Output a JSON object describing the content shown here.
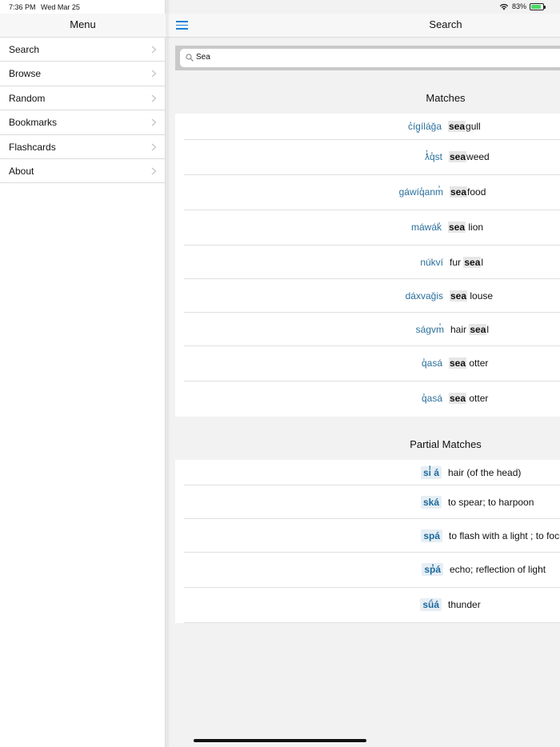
{
  "status": {
    "time": "7:36 PM",
    "date": "Wed Mar 25",
    "battery": "83%",
    "battery_level": 0.83,
    "battery_color": "#4cd964"
  },
  "sidebar": {
    "title": "Menu",
    "items": [
      {
        "label": "Search"
      },
      {
        "label": "Browse"
      },
      {
        "label": "Random"
      },
      {
        "label": "Bookmarks"
      },
      {
        "label": "Flashcards"
      },
      {
        "label": "About"
      }
    ]
  },
  "nav": {
    "title": "Search",
    "menu_icon": "hamburger-icon"
  },
  "search": {
    "value": "Sea",
    "icon": "search-icon"
  },
  "matches": {
    "title": "Matches",
    "rows": [
      {
        "word": "c̓íg̱íláǧa",
        "pre": "",
        "hl": "sea",
        "post": "gull"
      },
      {
        "word": "ƛ̓q̓st",
        "pre": "",
        "hl": "sea",
        "post": "weed"
      },
      {
        "word": "gáwíq̓anm̓",
        "pre": "",
        "hl": "sea",
        "post": "food"
      },
      {
        "word": "máwák̓",
        "pre": "",
        "hl": "sea",
        "post": " lion"
      },
      {
        "word": "núkví",
        "pre": "fur ",
        "hl": "sea",
        "post": "l"
      },
      {
        "word": "dáxvaǧis",
        "pre": "",
        "hl": "sea",
        "post": " louse"
      },
      {
        "word": "ságvm̓",
        "pre": "hair ",
        "hl": "sea",
        "post": "l"
      },
      {
        "word": "q̓asá",
        "pre": "",
        "hl": "sea",
        "post": " otter"
      },
      {
        "word": "q̓asá",
        "pre": "",
        "hl": "sea",
        "post": " otter"
      }
    ]
  },
  "partial": {
    "title": "Partial Matches",
    "rows": [
      {
        "word": "si̓ á",
        "gloss": "hair (of the head)"
      },
      {
        "word": "ská",
        "gloss": "to spear; to harpoon"
      },
      {
        "word": "spá",
        "gloss": "to flash with a light ; to focus a flashlight on someth"
      },
      {
        "word": "sp̓á",
        "gloss": "echo; reflection of light"
      },
      {
        "word": "sǘá",
        "gloss": "thunder"
      }
    ]
  },
  "colors": {
    "accent": "#1a7fd4",
    "word": "#2a6f9c"
  }
}
